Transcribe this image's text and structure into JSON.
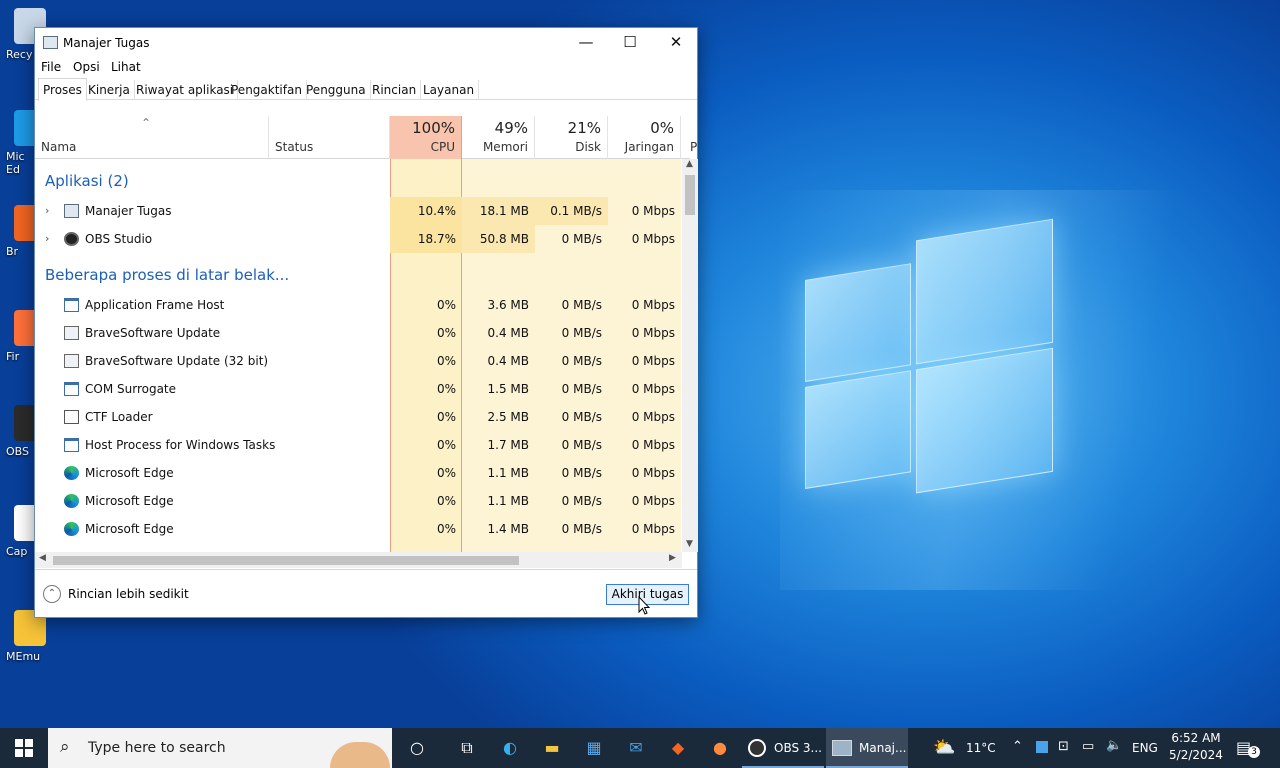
{
  "desktop": {
    "icons": [
      {
        "label": "Recy",
        "icon": "recycle-bin-icon",
        "color": "#c8d8e8"
      },
      {
        "label": "Mic\nEd",
        "icon": "edge-icon",
        "color": "#1e9be6"
      },
      {
        "label": "Br",
        "icon": "brave-icon",
        "color": "#f26522"
      },
      {
        "label": "Fir",
        "icon": "firefox-icon",
        "color": "#ff7139"
      },
      {
        "label": "OBS",
        "icon": "obs-icon",
        "color": "#2b2b2b"
      },
      {
        "label": "Cap",
        "icon": "capcut-icon",
        "color": "#ffffff"
      },
      {
        "label": "MEmu",
        "icon": "memu-icon",
        "color": "#f7c338"
      }
    ]
  },
  "window": {
    "title": "Manajer Tugas",
    "controls": {
      "minimize": "—",
      "maximize": "☐",
      "close": "✕"
    },
    "menu": [
      "File",
      "Opsi",
      "Lihat"
    ],
    "tabs": [
      "Proses",
      "Kinerja",
      "Riwayat aplikasi",
      "Pengaktifan",
      "Pengguna",
      "Rincian",
      "Layanan"
    ],
    "active_tab": "Proses",
    "columns": {
      "name": "Nama",
      "status": "Status",
      "cpu_pct": "100%",
      "cpu": "CPU",
      "mem_pct": "49%",
      "mem": "Memori",
      "disk_pct": "21%",
      "disk": "Disk",
      "net_pct": "0%",
      "net": "Jaringan",
      "extra": "P"
    },
    "groups": {
      "apps": "Aplikasi (2)",
      "background": "Beberapa proses di latar belak..."
    },
    "apps": [
      {
        "name": "Manajer Tugas",
        "icon": "task-manager-icon",
        "cpu": "10.4%",
        "mem": "18.1 MB",
        "disk": "0.1 MB/s",
        "net": "0 Mbps"
      },
      {
        "name": "OBS Studio",
        "icon": "obs-icon",
        "cpu": "18.7%",
        "mem": "50.8 MB",
        "disk": "0 MB/s",
        "net": "0 Mbps"
      }
    ],
    "background": [
      {
        "name": "Application Frame Host",
        "icon": "app-window-icon",
        "cpu": "0%",
        "mem": "3.6 MB",
        "disk": "0 MB/s",
        "net": "0 Mbps"
      },
      {
        "name": "BraveSoftware Update",
        "icon": "updater-icon",
        "cpu": "0%",
        "mem": "0.4 MB",
        "disk": "0 MB/s",
        "net": "0 Mbps"
      },
      {
        "name": "BraveSoftware Update (32 bit)",
        "icon": "updater-icon",
        "cpu": "0%",
        "mem": "0.4 MB",
        "disk": "0 MB/s",
        "net": "0 Mbps"
      },
      {
        "name": "COM Surrogate",
        "icon": "app-window-icon",
        "cpu": "0%",
        "mem": "1.5 MB",
        "disk": "0 MB/s",
        "net": "0 Mbps"
      },
      {
        "name": "CTF Loader",
        "icon": "ctf-loader-icon",
        "cpu": "0%",
        "mem": "2.5 MB",
        "disk": "0 MB/s",
        "net": "0 Mbps"
      },
      {
        "name": "Host Process for Windows Tasks",
        "icon": "app-window-icon",
        "cpu": "0%",
        "mem": "1.7 MB",
        "disk": "0 MB/s",
        "net": "0 Mbps"
      },
      {
        "name": "Microsoft Edge",
        "icon": "edge-icon",
        "cpu": "0%",
        "mem": "1.1 MB",
        "disk": "0 MB/s",
        "net": "0 Mbps"
      },
      {
        "name": "Microsoft Edge",
        "icon": "edge-icon",
        "cpu": "0%",
        "mem": "1.1 MB",
        "disk": "0 MB/s",
        "net": "0 Mbps"
      },
      {
        "name": "Microsoft Edge",
        "icon": "edge-icon",
        "cpu": "0%",
        "mem": "1.4 MB",
        "disk": "0 MB/s",
        "net": "0 Mbps"
      }
    ],
    "footer": {
      "fewer_details": "Rincian lebih sedikit",
      "end_task": "Akhiri tugas"
    }
  },
  "taskbar": {
    "search_placeholder": "Type here to search",
    "pinned": [
      {
        "icon": "cortana-icon"
      },
      {
        "icon": "task-view-icon"
      },
      {
        "icon": "edge-icon"
      },
      {
        "icon": "file-explorer-icon"
      },
      {
        "icon": "store-icon"
      },
      {
        "icon": "mail-icon"
      },
      {
        "icon": "brave-icon"
      },
      {
        "icon": "firefox-icon"
      }
    ],
    "running": [
      {
        "label": "OBS 3...",
        "icon": "obs-icon"
      },
      {
        "label": "Manaj...",
        "icon": "task-manager-icon"
      }
    ],
    "weather": "11°C",
    "language": "ENG",
    "time": "6:52 AM",
    "date": "5/2/2024",
    "notifications": "3"
  },
  "colors": {
    "cpu_header_bg": "#f9c4ae",
    "cpu_cell_high": "#fbe3a0",
    "cpu_cell_low": "#fdf1c8",
    "group_text": "#1d5fb8",
    "taskbar_bg": "#1b2a3a"
  }
}
